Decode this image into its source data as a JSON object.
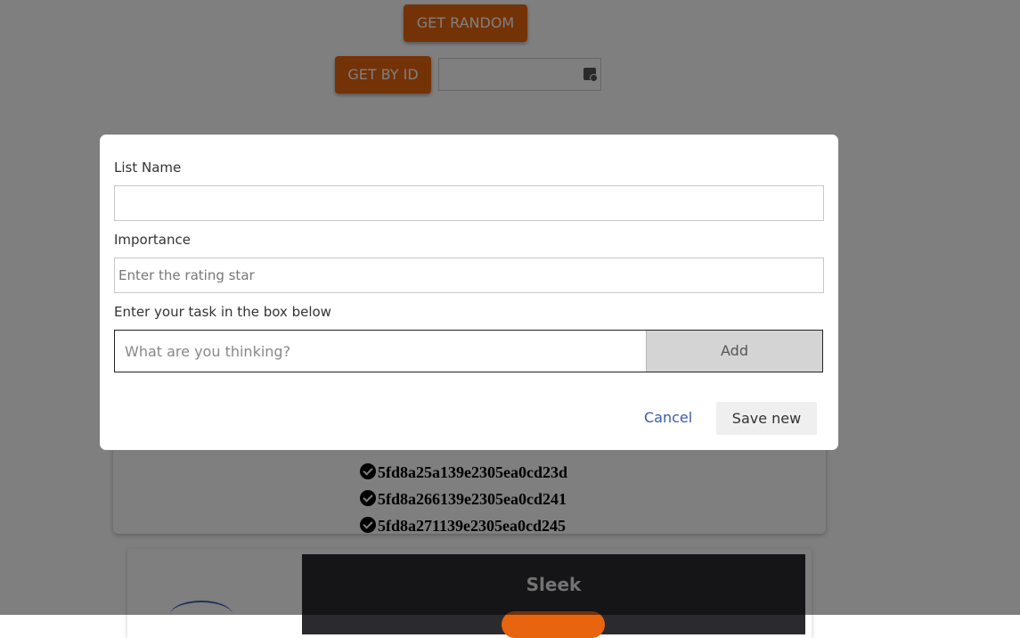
{
  "background": {
    "get_random_label": "GET RANDOM",
    "get_by_id_label": "GET BY ID",
    "id_input_value": "",
    "ids": [
      "5fd8a25a139e2305ea0cd23d",
      "5fd8a266139e2305ea0cd241",
      "5fd8a271139e2305ea0cd245"
    ],
    "product_title": "Sleek",
    "accent_color": "#e8640e"
  },
  "modal": {
    "list_name_label": "List Name",
    "list_name_value": "",
    "importance_label": "Importance",
    "importance_placeholder": "Enter the rating star",
    "task_label": "Enter your task in the box below",
    "task_placeholder": "What are you thinking?",
    "add_label": "Add",
    "cancel_label": "Cancel",
    "save_label": "Save new"
  }
}
